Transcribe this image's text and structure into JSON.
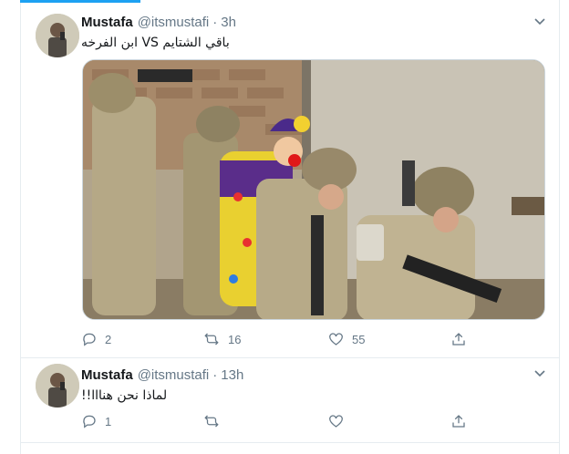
{
  "colors": {
    "accent": "#1da1f2",
    "secondary_text": "#657786",
    "border": "#e6ecf0"
  },
  "tweets": [
    {
      "name": "Mustafa",
      "handle": "@itsmustafi",
      "separator": "·",
      "time": "3h",
      "text": "باقي الشتايم VS ابن الفرخه",
      "has_media": true,
      "media_icon": "photo-soldiers-with-clown",
      "actions": {
        "reply_count": "2",
        "retweet_count": "16",
        "like_count": "55",
        "share_count": ""
      }
    },
    {
      "name": "Mustafa",
      "handle": "@itsmustafi",
      "separator": "·",
      "time": "13h",
      "text": "لماذا نحن هنااا!!",
      "has_media": false,
      "actions": {
        "reply_count": "1",
        "retweet_count": "",
        "like_count": "",
        "share_count": ""
      }
    }
  ],
  "icons": [
    "reply-icon",
    "retweet-icon",
    "like-icon",
    "share-icon",
    "chevron-down-icon"
  ]
}
